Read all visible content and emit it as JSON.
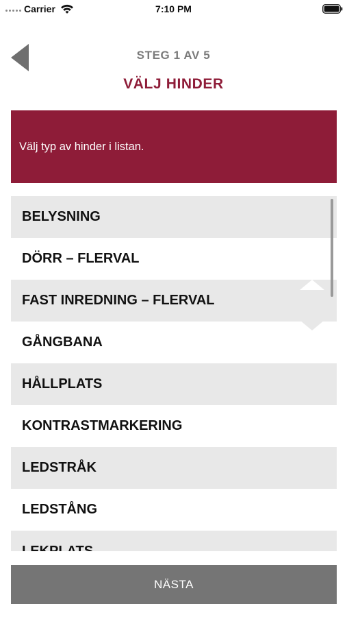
{
  "status_bar": {
    "carrier": "Carrier",
    "time": "7:10 PM"
  },
  "header": {
    "step": "STEG 1 AV 5",
    "title": "VÄLJ HINDER"
  },
  "banner": {
    "text": "Välj typ av hinder i listan.",
    "color": "#8e1c38"
  },
  "obstacle_list": {
    "items": [
      {
        "label": "BELYSNING"
      },
      {
        "label": "DÖRR – FLERVAL"
      },
      {
        "label": "FAST INREDNING – FLERVAL"
      },
      {
        "label": "GÅNGBANA"
      },
      {
        "label": "HÅLLPLATS"
      },
      {
        "label": "KONTRASTMARKERING"
      },
      {
        "label": "LEDSTRÅK"
      },
      {
        "label": "LEDSTÅNG"
      },
      {
        "label": "LEKPLATS"
      }
    ]
  },
  "footer": {
    "next_label": "NÄSTA"
  },
  "icons": {
    "back": "back-arrow-icon",
    "signal": "cellular-signal-icon",
    "wifi": "wifi-icon",
    "battery": "battery-icon"
  },
  "colors": {
    "accent": "#8e1c38",
    "row_shade": "#e8e8e8",
    "step_text": "#7b7b7b",
    "button": "#757575"
  }
}
